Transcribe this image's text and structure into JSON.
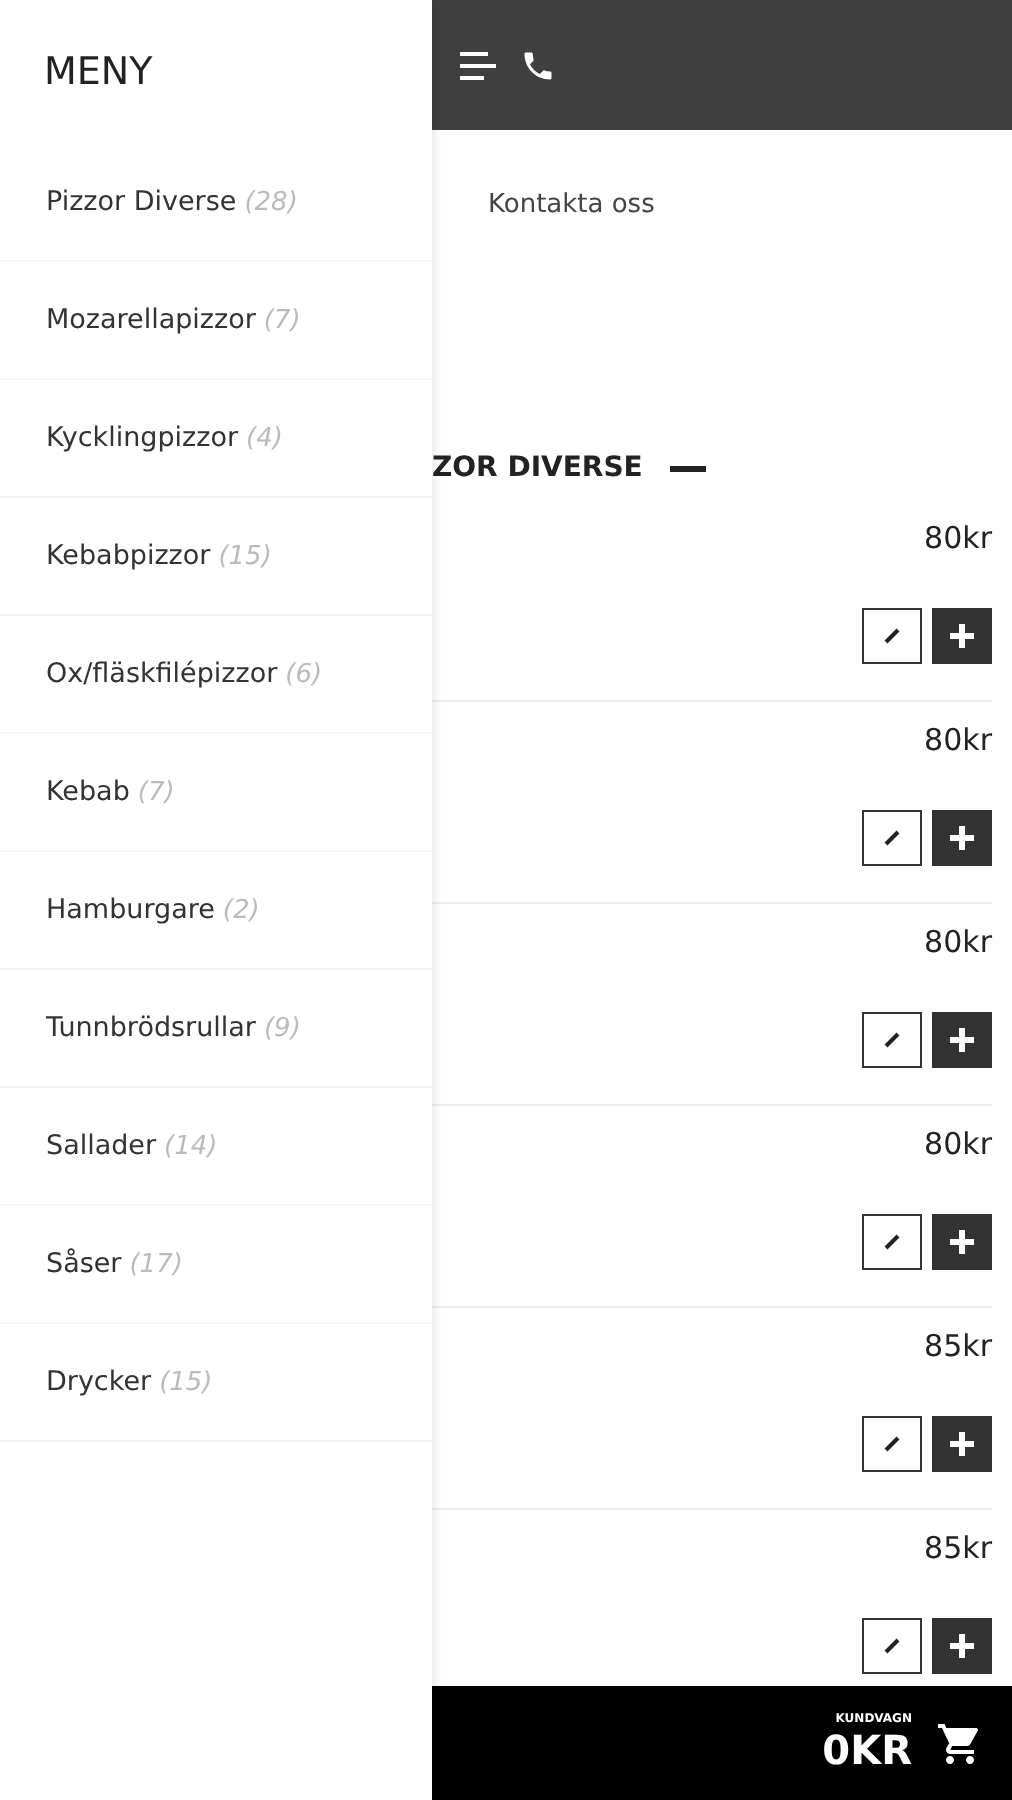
{
  "menu": {
    "title": "MENY",
    "items": [
      {
        "name": "Pizzor Diverse",
        "count": "(28)"
      },
      {
        "name": "Mozarellapizzor",
        "count": "(7)"
      },
      {
        "name": "Kycklingpizzor",
        "count": "(4)"
      },
      {
        "name": "Kebabpizzor",
        "count": "(15)"
      },
      {
        "name": "Ox/fläskfilépizzor",
        "count": "(6)"
      },
      {
        "name": "Kebab",
        "count": "(7)"
      },
      {
        "name": "Hamburgare",
        "count": "(2)"
      },
      {
        "name": "Tunnbrödsrullar",
        "count": "(9)"
      },
      {
        "name": "Sallader",
        "count": "(14)"
      },
      {
        "name": "Såser",
        "count": "(17)"
      },
      {
        "name": "Drycker",
        "count": "(15)"
      }
    ]
  },
  "breadcrumb": {
    "link": "Kontakta oss"
  },
  "section": {
    "title": "ZOR DIVERSE",
    "expanded": true
  },
  "products": [
    {
      "price": "80kr"
    },
    {
      "price": "80kr"
    },
    {
      "price": "80kr"
    },
    {
      "price": "80kr"
    },
    {
      "price": "85kr"
    },
    {
      "price": "85kr"
    }
  ],
  "cart": {
    "label": "KUNDVAGN",
    "total": "0KR"
  }
}
